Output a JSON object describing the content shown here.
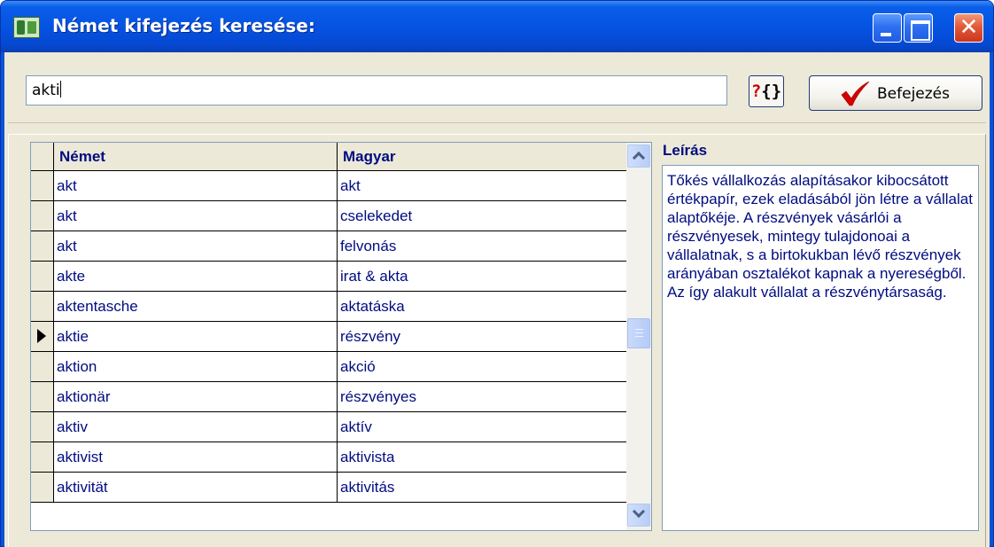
{
  "window": {
    "title": "Német kifejezés keresése:"
  },
  "search": {
    "value": "akti"
  },
  "toolbar": {
    "help_label": "?{}",
    "finish_label": "Befejezés"
  },
  "grid": {
    "columns": [
      "Német",
      "Magyar"
    ],
    "selected_index": 5,
    "rows": [
      {
        "de": "akt",
        "hu": "akt"
      },
      {
        "de": "akt",
        "hu": "cselekedet"
      },
      {
        "de": "akt",
        "hu": "felvonás"
      },
      {
        "de": "akte",
        "hu": "irat & akta"
      },
      {
        "de": "aktentasche",
        "hu": "aktatáska"
      },
      {
        "de": "aktie",
        "hu": "részvény"
      },
      {
        "de": "aktion",
        "hu": "akció"
      },
      {
        "de": "aktionär",
        "hu": "részvényes"
      },
      {
        "de": "aktiv",
        "hu": "aktív"
      },
      {
        "de": "aktivist",
        "hu": "aktivista"
      },
      {
        "de": "aktivität",
        "hu": "aktivitás"
      }
    ]
  },
  "description": {
    "title": "Leírás",
    "text": "Tőkés vállalkozás alapításakor kibocsátott értékpapír, ezek eladásából jön létre a vállalat alaptőkéje. A részvények vásárlói a részvényesek, mintegy tulajdonoai a vállalatnak, s a birtokukban lévő részvények arányában osztalékot kapnak a nyereségből. Az így alakult vállalat a részvénytársaság."
  },
  "colors": {
    "titlebar": "#0553E2",
    "text_blue": "#000C80",
    "face": "#ECE9D8",
    "close_red": "#E35A3A"
  }
}
